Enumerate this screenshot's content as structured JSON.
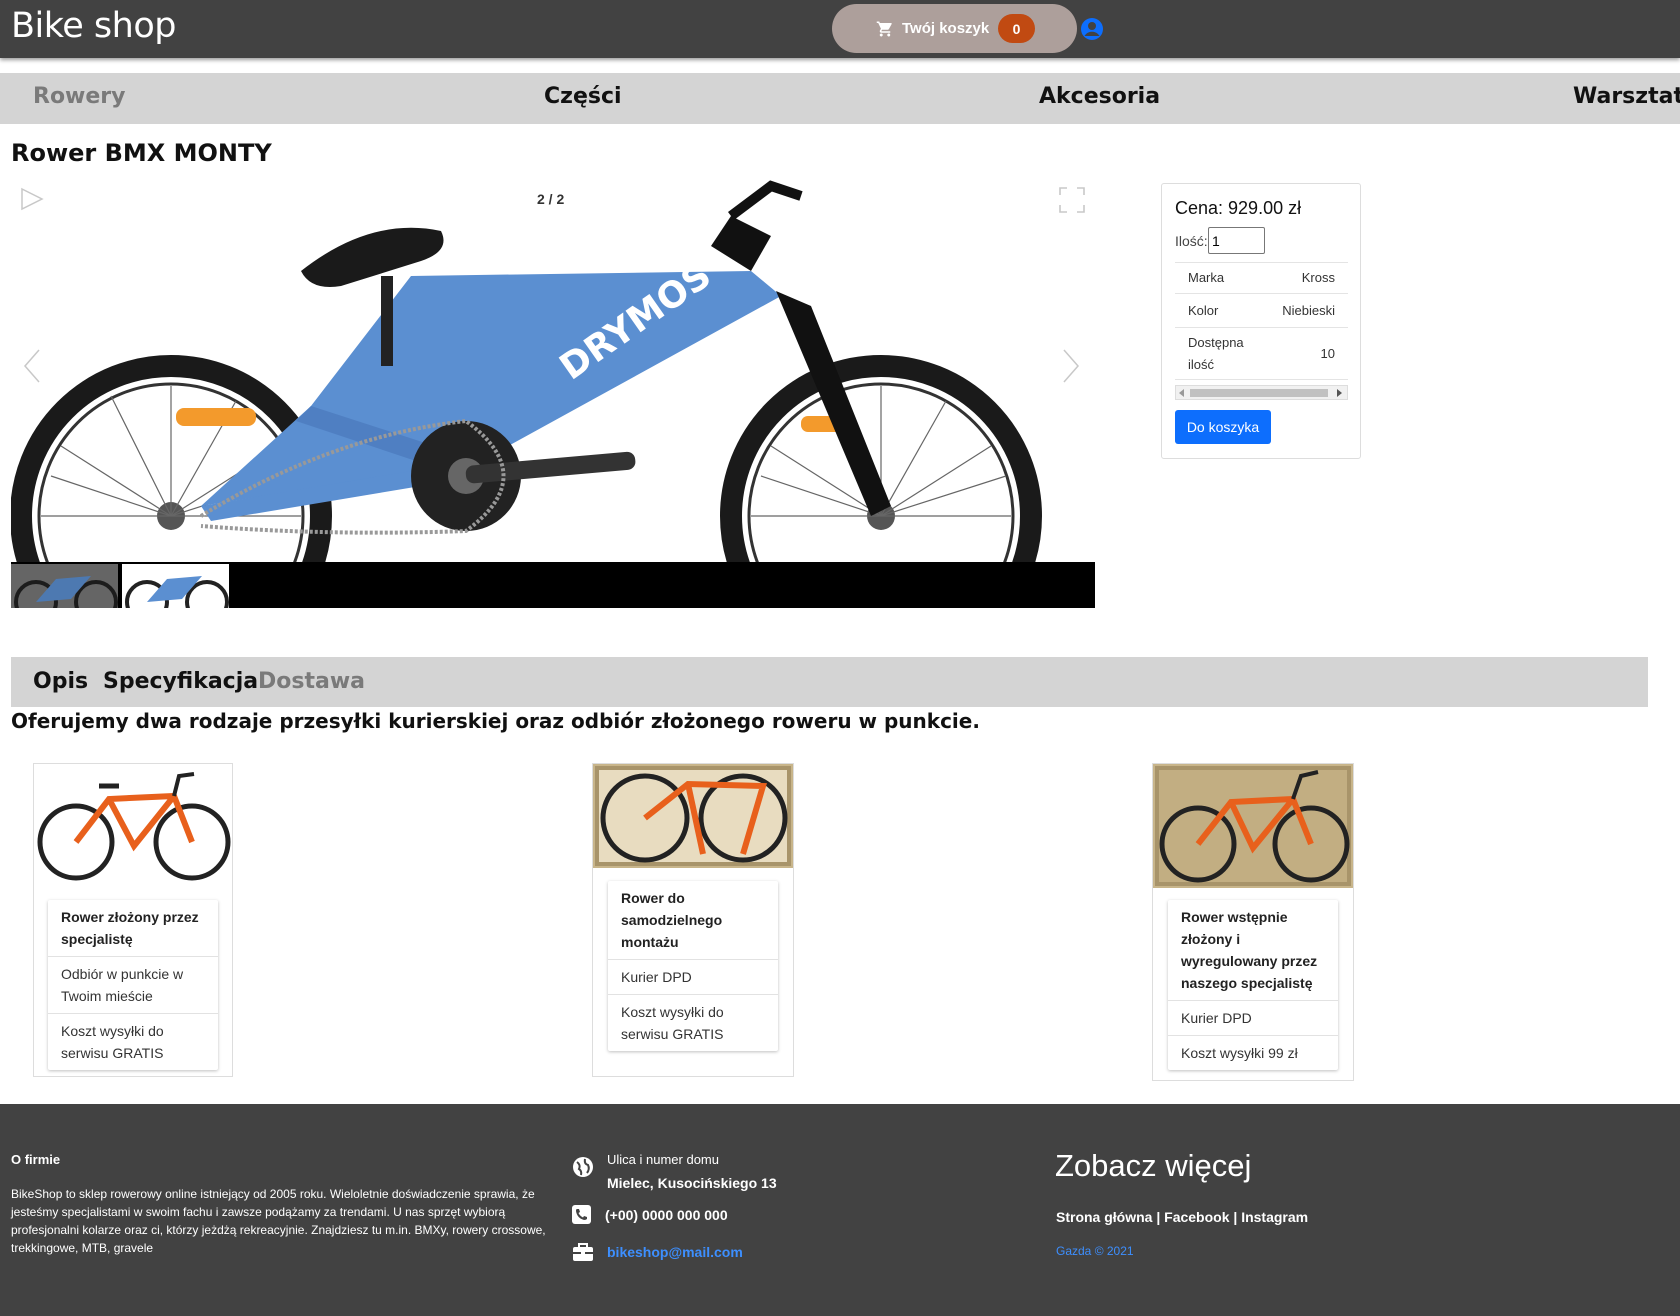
{
  "header": {
    "brand": "Bike shop",
    "cart_label": "Twój koszyk",
    "cart_count": "0"
  },
  "nav": {
    "items": [
      "Rowery",
      "Części",
      "Akcesoria",
      "Warsztat"
    ],
    "active": "Rowery"
  },
  "product": {
    "title": "Rower BMX MONTY",
    "gallery_counter": "2 / 2",
    "frame_text": "DRYMOS",
    "price": "Cena: 929.00 zł",
    "qty_label": "Ilość:",
    "qty_value": "1",
    "specs": [
      {
        "label": "Marka",
        "value": "Kross"
      },
      {
        "label": "Kolor",
        "value": "Niebieski"
      },
      {
        "label": "Dostępna ilość",
        "value": "10"
      }
    ],
    "add_to_cart": "Do koszyka"
  },
  "tabs": {
    "items": [
      "Opis",
      "Specyfikacja",
      "Dostawa"
    ],
    "active": "Dostawa"
  },
  "delivery": {
    "heading": "Oferujemy dwa rodzaje przesyłki kurierskiej oraz odbiór złożonego roweru w punkcie.",
    "options": [
      {
        "title": "Rower złożony przez specjalistę",
        "lines": [
          "Odbiór w punkcie w Twoim mieście",
          "Koszt wysyłki do serwisu GRATIS"
        ]
      },
      {
        "title": "Rower do samodzielnego montażu",
        "lines": [
          "Kurier DPD",
          "Koszt wysyłki do serwisu GRATIS"
        ]
      },
      {
        "title": "Rower wstępnie złożony i wyregulowany przez naszego specjalistę",
        "lines": [
          "Kurier DPD",
          "Koszt wysyłki 99 zł"
        ]
      }
    ]
  },
  "footer": {
    "about_title": "O firmie",
    "about_text": "BikeShop to sklep rowerowy online istniejący od 2005 roku. Wieloletnie doświadczenie sprawia, że jesteśmy specjalistami w swoim fachu i zawsze podążamy za trendami. U nas sprzęt wybiorą profesjonalni kolarze oraz ci, którzy jeżdżą rekreacyjnie. Znajdziesz tu m.in. BMXy, rowery crossowe, trekkingowe, MTB, gravele",
    "street_label": "Ulica i numer domu",
    "street": "Mielec, Kusocińskiego 13",
    "phone": "(+00) 0000 000 000",
    "email": "bikeshop@mail.com",
    "more_title": "Zobacz więcej",
    "links": "Strona główna | Facebook | Instagram",
    "copyright": "Gazda © 2021"
  },
  "colors": {
    "topbar": "#424242",
    "nav_bg": "#d4d4d4",
    "cart_pill": "#ad9f9b",
    "cart_badge": "#c14a12",
    "primary": "#0d6efd",
    "link": "#3d8fff",
    "bike_blue": "#5b8fd1",
    "delivery_bike": "#e8601c"
  },
  "icons": [
    "cart-icon",
    "user-icon",
    "play-icon",
    "fullscreen-icon",
    "prev-arrow-icon",
    "next-arrow-icon",
    "globe-icon",
    "phone-icon",
    "briefcase-icon"
  ]
}
